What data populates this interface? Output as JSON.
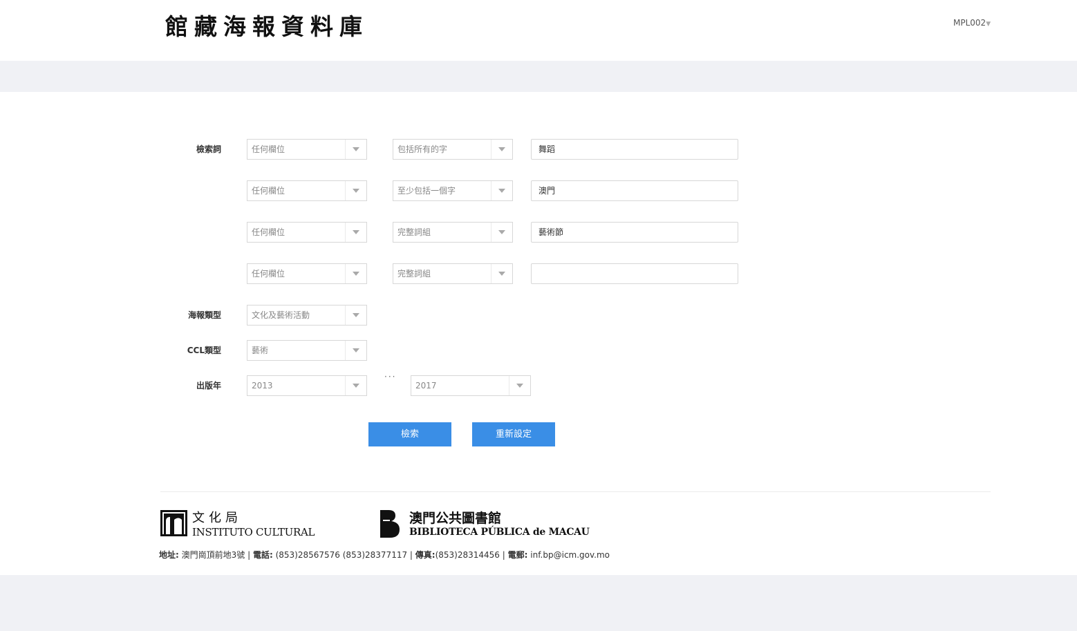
{
  "header": {
    "site_title": "館藏海報資料庫",
    "user_label": "MPL002"
  },
  "search_terms": {
    "label": "檢索詞",
    "rows": [
      {
        "field": "任何欄位",
        "match": "包括所有的字",
        "value": "舞蹈"
      },
      {
        "field": "任何欄位",
        "match": "至少包括一個字",
        "value": "澳門"
      },
      {
        "field": "任何欄位",
        "match": "完整詞組",
        "value": "藝術節"
      },
      {
        "field": "任何欄位",
        "match": "完整詞組",
        "value": ""
      }
    ]
  },
  "poster_type": {
    "label": "海報類型",
    "value": "文化及藝術活動"
  },
  "ccl_type": {
    "label": "CCL類型",
    "value": "藝術"
  },
  "pub_year": {
    "label": "出版年",
    "from": "2013",
    "separator": "···",
    "to": "2017"
  },
  "buttons": {
    "search": "檢索",
    "reset": "重新設定"
  },
  "footer": {
    "ic_cn": "文化局",
    "ic_en": "INSTITUTO CULTURAL",
    "bp_cn": "澳門公共圖書館",
    "bp_en": "BIBLIOTECA PÚBLICA de MACAU",
    "address_label": "地址:",
    "address": "澳門崗頂前地3號",
    "phone_label": "電話:",
    "phone": "(853)28567576 (853)28377117",
    "fax_label": "傳真:",
    "fax": "(853)28314456",
    "email_label": "電郵:",
    "email": "inf.bp@icm.gov.mo"
  },
  "colors": {
    "primary": "#3a8ee6",
    "background": "#f0f1f5"
  }
}
